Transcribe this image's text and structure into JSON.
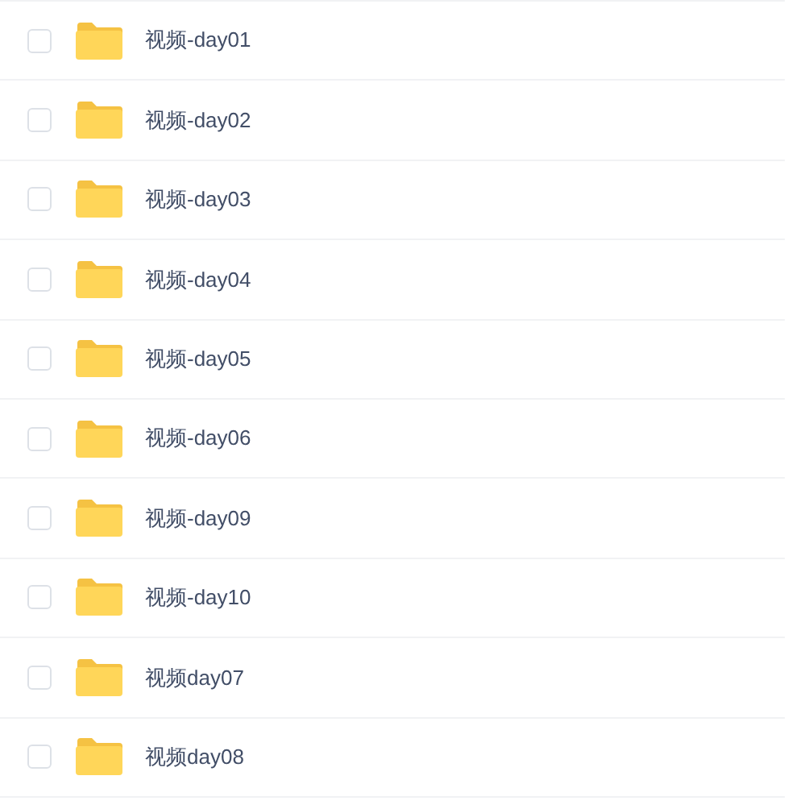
{
  "files": [
    {
      "name": "视频-day01",
      "checked": false
    },
    {
      "name": "视频-day02",
      "checked": false
    },
    {
      "name": "视频-day03",
      "checked": false
    },
    {
      "name": "视频-day04",
      "checked": false
    },
    {
      "name": "视频-day05",
      "checked": false
    },
    {
      "name": "视频-day06",
      "checked": false
    },
    {
      "name": "视频-day09",
      "checked": false
    },
    {
      "name": "视频-day10",
      "checked": false
    },
    {
      "name": "视频day07",
      "checked": false
    },
    {
      "name": "视频day08",
      "checked": false
    }
  ]
}
